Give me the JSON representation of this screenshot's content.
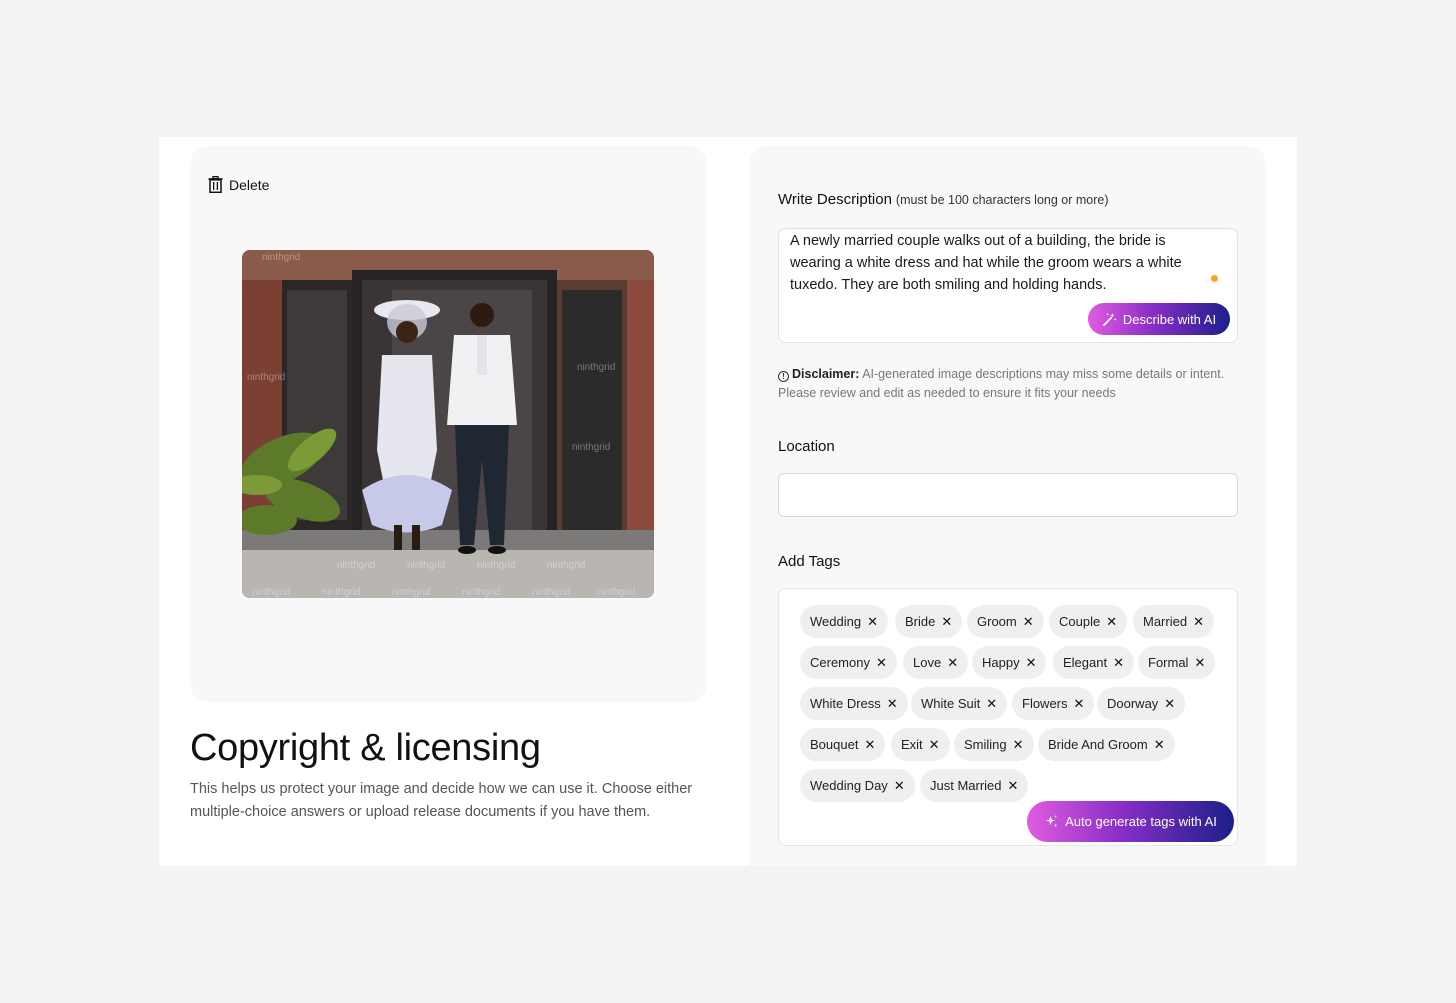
{
  "left": {
    "delete_label": "Delete",
    "photo_watermark": "ninthgrid",
    "copyright_title": "Copyright & licensing",
    "copyright_desc": "This helps us protect your image and decide how we can use it. Choose either multiple-choice answers or upload release documents if you have them."
  },
  "description": {
    "label": "Write Description",
    "hint": "(must be 100 characters long or more)",
    "text": "A newly married couple walks out of a building, the bride is wearing a white dress and hat while the groom wears a white tuxedo. They are both smiling and holding hands.",
    "ai_button": "Describe with AI"
  },
  "disclaimer": {
    "label": "Disclaimer:",
    "text": "AI-generated image descriptions may miss some details or intent. Please review and edit as needed to ensure it fits your needs"
  },
  "location": {
    "label": "Location",
    "value": ""
  },
  "tags": {
    "label": "Add Tags",
    "items": [
      "Wedding",
      "Bride",
      "Groom",
      "Couple",
      "Married",
      "Ceremony",
      "Love",
      "Happy",
      "Elegant",
      "Formal",
      "White Dress",
      "White Suit",
      "Flowers",
      "Doorway",
      "Bouquet",
      "Exit",
      "Smiling",
      "Bride And Groom",
      "Wedding Day",
      "Just Married"
    ],
    "remove_symbol": "✕",
    "ai_button": "Auto generate tags with AI"
  },
  "colors": {
    "accent_start": "#e05ce0",
    "accent_end": "#1b1f8a",
    "indicator": "#f5a623"
  }
}
